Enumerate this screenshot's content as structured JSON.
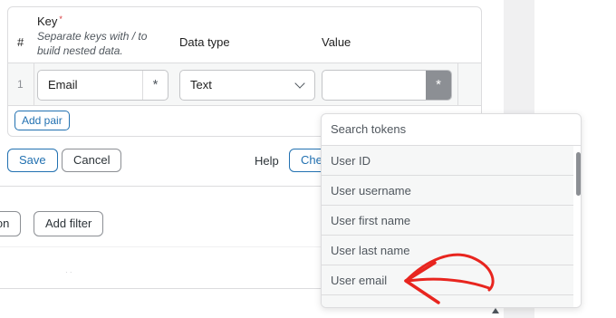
{
  "table": {
    "col_hash": "#",
    "col_key": "Key",
    "col_key_required": "*",
    "col_key_hint": "Separate keys with / to build nested data.",
    "col_type": "Data type",
    "col_value": "Value",
    "rows": [
      {
        "index": "1",
        "key": "Email",
        "data_type": "Text",
        "value": ""
      }
    ],
    "token_button": "*",
    "add_pair_label": "Add pair"
  },
  "actions": {
    "save_label": "Save",
    "cancel_label": "Cancel",
    "help_label": "Help",
    "check_label": "Che"
  },
  "filters": {
    "partial_button_label": "ion",
    "add_filter_label": "Add filter"
  },
  "token_dropdown": {
    "search_placeholder": "Search tokens",
    "items": [
      {
        "label": "User ID"
      },
      {
        "label": "User username"
      },
      {
        "label": "User first name"
      },
      {
        "label": "User last name"
      },
      {
        "label": "User email"
      }
    ]
  },
  "colors": {
    "accent": "#2271b1",
    "annotation": "#e8251f",
    "required": "#d63638"
  }
}
